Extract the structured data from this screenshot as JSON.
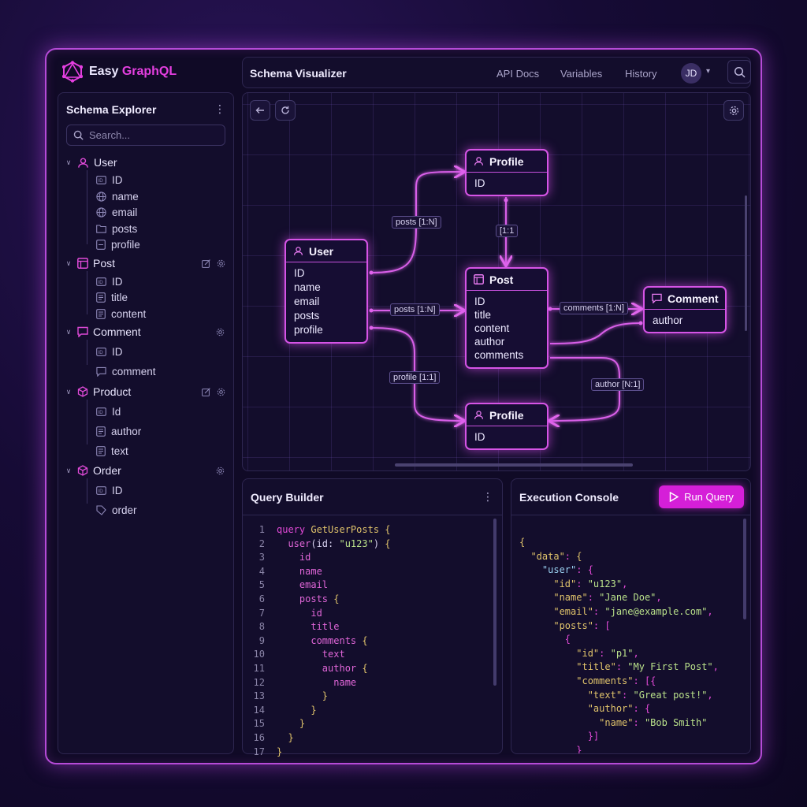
{
  "app": {
    "logo_plain": "Easy ",
    "logo_accent": "GraphQL",
    "view_title": "Schema Visualizer",
    "nav": [
      "API Docs",
      "Variables",
      "History"
    ],
    "user_initials": "JD",
    "accent_color": "#d51fd8",
    "glow_color": "#d654e6"
  },
  "sidebar": {
    "title": "Schema Explorer",
    "search_placeholder": "Search...",
    "types": [
      {
        "name": "User",
        "icon": "user-icon",
        "fields": [
          {
            "name": "ID",
            "icon": "id-icon"
          },
          {
            "name": "name",
            "icon": "globe-icon"
          },
          {
            "name": "email",
            "icon": "globe-icon"
          },
          {
            "name": "posts",
            "icon": "folder-link-icon"
          },
          {
            "name": "profile",
            "icon": "document-icon"
          }
        ]
      },
      {
        "name": "Post",
        "icon": "window-icon",
        "fields": [
          {
            "name": "ID",
            "icon": "id-icon"
          },
          {
            "name": "title",
            "icon": "text-icon"
          },
          {
            "name": "content",
            "icon": "text-icon"
          }
        ]
      },
      {
        "name": "Comment",
        "icon": "chat-icon",
        "fields": [
          {
            "name": "ID",
            "icon": "id-icon"
          },
          {
            "name": "comment",
            "icon": "chat-icon"
          }
        ]
      },
      {
        "name": "Product",
        "icon": "cube-icon",
        "fields": [
          {
            "name": "Id",
            "icon": "id-icon"
          },
          {
            "name": "author",
            "icon": "text-icon"
          },
          {
            "name": "text",
            "icon": "text-icon"
          }
        ]
      },
      {
        "name": "Order",
        "icon": "cube-icon",
        "fields": [
          {
            "name": "ID",
            "icon": "id-icon"
          },
          {
            "name": "order",
            "icon": "tag-icon"
          }
        ]
      }
    ]
  },
  "visualizer": {
    "nodes": {
      "profile_top": {
        "title": "Profile",
        "fields": [
          "ID"
        ]
      },
      "user": {
        "title": "User",
        "fields": [
          "ID",
          "name",
          "email",
          "posts",
          "profile"
        ]
      },
      "post": {
        "title": "Post",
        "fields": [
          "ID",
          "title",
          "content",
          "author",
          "comments"
        ]
      },
      "comment": {
        "title": "Comment",
        "fields": [
          "author"
        ]
      },
      "profile_bottom": {
        "title": "Profile",
        "fields": [
          "ID"
        ]
      }
    },
    "edges": {
      "user_profile_top": "posts [1:N]",
      "profile_post": "[1:1",
      "user_post": "posts [1:N]",
      "post_comment": "comments [1:N]",
      "user_profile_bottom": "profile [1:1]",
      "comment_profile": "author [N:1]"
    }
  },
  "query_builder": {
    "title": "Query Builder",
    "lines": [
      [
        [
          "kw",
          "query "
        ],
        [
          "fn",
          "GetUserPosts "
        ],
        [
          "brace",
          "{"
        ]
      ],
      [
        [
          "fld",
          "  user"
        ],
        [
          "punct",
          "(id: "
        ],
        [
          "str",
          "\"u123\""
        ],
        [
          "punct",
          ") "
        ],
        [
          "brace",
          "{"
        ]
      ],
      [
        [
          "fld",
          "    id"
        ]
      ],
      [
        [
          "fld",
          "    name"
        ]
      ],
      [
        [
          "fld",
          "    email"
        ]
      ],
      [
        [
          "fld",
          "    posts "
        ],
        [
          "brace",
          "{"
        ]
      ],
      [
        [
          "fld",
          "      id"
        ]
      ],
      [
        [
          "fld",
          "      title"
        ]
      ],
      [
        [
          "fld",
          "      comments "
        ],
        [
          "brace",
          "{"
        ]
      ],
      [
        [
          "fld",
          "        text"
        ]
      ],
      [
        [
          "fld",
          "        author "
        ],
        [
          "brace",
          "{"
        ]
      ],
      [
        [
          "fld",
          "          name"
        ]
      ],
      [
        [
          "brace",
          "        }"
        ]
      ],
      [
        [
          "brace",
          "      }"
        ]
      ],
      [
        [
          "brace",
          "    }"
        ]
      ],
      [
        [
          "brace",
          "  }"
        ]
      ],
      [
        [
          "brace",
          "}"
        ]
      ]
    ]
  },
  "console": {
    "title": "Execution Console",
    "run_label": "Run Query",
    "lines": [
      [
        [
          "jk",
          "{"
        ]
      ],
      [
        [
          "jk",
          "  \"data\""
        ],
        [
          "jp",
          ": "
        ],
        [
          "jk",
          "{"
        ]
      ],
      [
        [
          "jk2",
          "    \"user\""
        ],
        [
          "jp",
          ": {"
        ]
      ],
      [
        [
          "jk",
          "      \"id\""
        ],
        [
          "jp",
          ": "
        ],
        [
          "jv",
          "\"u123\""
        ],
        [
          "jp",
          ","
        ]
      ],
      [
        [
          "jk",
          "      \"name\""
        ],
        [
          "jp",
          ": "
        ],
        [
          "jv",
          "\"Jane Doe\""
        ],
        [
          "jp",
          ","
        ]
      ],
      [
        [
          "jk",
          "      \"email\""
        ],
        [
          "jp",
          ": "
        ],
        [
          "jv",
          "\"jane@example.com\""
        ],
        [
          "jp",
          ","
        ]
      ],
      [
        [
          "jk",
          "      \"posts\""
        ],
        [
          "jp",
          ": ["
        ]
      ],
      [
        [
          "jp",
          "        {"
        ]
      ],
      [
        [
          "jk",
          "          \"id\""
        ],
        [
          "jp",
          ": "
        ],
        [
          "jv",
          "\"p1\""
        ],
        [
          "jp",
          ","
        ]
      ],
      [
        [
          "jk",
          "          \"title\""
        ],
        [
          "jp",
          ": "
        ],
        [
          "jv",
          "\"My First Post\""
        ],
        [
          "jp",
          ","
        ]
      ],
      [
        [
          "jk",
          "          \"comments\""
        ],
        [
          "jp",
          ": [{"
        ]
      ],
      [
        [
          "jk",
          "            \"text\""
        ],
        [
          "jp",
          ": "
        ],
        [
          "jv",
          "\"Great post!\""
        ],
        [
          "jp",
          ","
        ]
      ],
      [
        [
          "jk",
          "            \"author\""
        ],
        [
          "jp",
          ": {"
        ]
      ],
      [
        [
          "jk",
          "              \"name\""
        ],
        [
          "jp",
          ": "
        ],
        [
          "jv",
          "\"Bob Smith\""
        ]
      ],
      [
        [
          "jp",
          "            }]"
        ]
      ],
      [
        [
          "jp",
          "          }"
        ]
      ]
    ]
  }
}
